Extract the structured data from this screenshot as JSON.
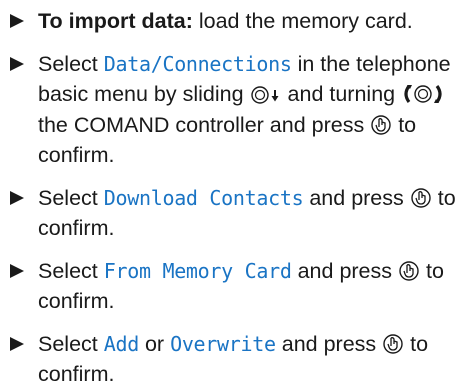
{
  "steps": [
    {
      "lead": "To import data:",
      "text": "load the memory card."
    },
    {
      "t1": "Select",
      "menu": "Data/Connections",
      "t2": "in the telephone basic menu by sliding",
      "t3": "and turning",
      "t4": "the COMAND controller and press",
      "t5": "to confirm."
    },
    {
      "t1": "Select",
      "menu": "Download Contacts",
      "t2": "and press",
      "t3": "to confirm."
    },
    {
      "t1": "Select",
      "menu": "From Memory Card",
      "t2": "and press",
      "t3": "to confirm."
    },
    {
      "t1": "Select",
      "menu1": "Add",
      "t2": "or",
      "menu2": "Overwrite",
      "t3": "and press",
      "t4": "to confirm."
    }
  ],
  "icons": {
    "slide_down": "controller-slide-down-icon",
    "turn": "controller-turn-icon",
    "press": "controller-press-icon"
  },
  "colors": {
    "menu_text": "#1a74c4",
    "body_text": "#1a1a1a"
  }
}
